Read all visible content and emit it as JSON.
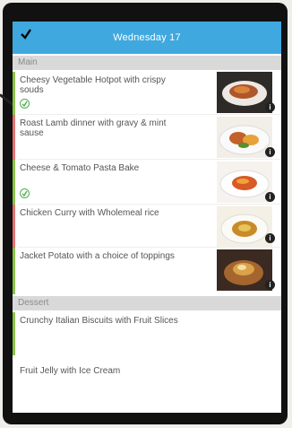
{
  "header": {
    "title": "Wednesday 17",
    "check_icon": "checkmark-icon",
    "background_color": "#3fa8df"
  },
  "sections": {
    "main": "Main",
    "dessert": "Dessert"
  },
  "main_items": [
    {
      "name": "Cheesy Vegetable Hotpot with crispy souds",
      "vegetarian": true,
      "bar_color": "#8bc34a"
    },
    {
      "name": "Roast Lamb dinner with gravy & mint sause",
      "vegetarian": false,
      "bar_color": "#e57373"
    },
    {
      "name": "Cheese & Tomato Pasta Bake",
      "vegetarian": true,
      "bar_color": "#8bc34a"
    },
    {
      "name": "Chicken Curry with Wholemeal rice",
      "vegetarian": false,
      "bar_color": "#e57373"
    },
    {
      "name": "Jacket Potato with a choice of toppings",
      "vegetarian": true,
      "bar_color": "#8bc34a"
    }
  ],
  "dessert_items": [
    {
      "name": "Crunchy Italian Biscuits with Fruit Slices",
      "bar_color": "#8bc34a"
    },
    {
      "name": "Fruit Jelly with Ice Cream",
      "bar_color": ""
    }
  ],
  "icons": {
    "vegetarian": "vegetarian-leaf-icon",
    "info": "info-icon"
  }
}
